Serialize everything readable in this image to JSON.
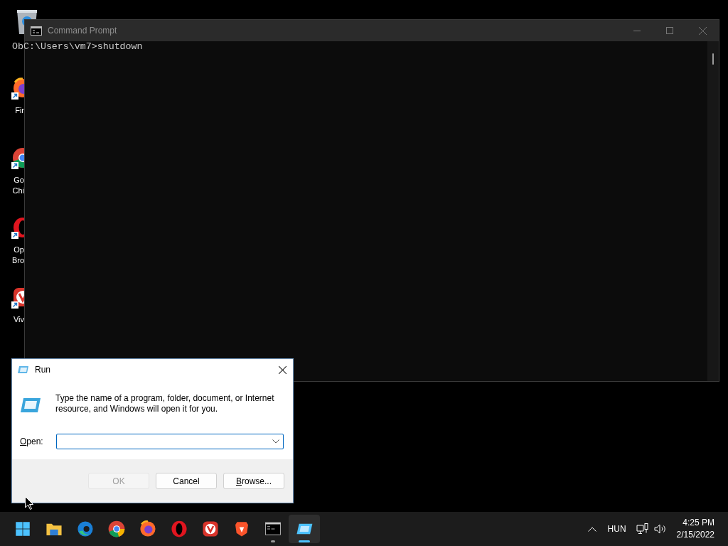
{
  "desktop_icons": [
    {
      "kind": "recycle-bin"
    },
    {
      "kind": "firefox",
      "label_lines": [
        "Fir"
      ]
    },
    {
      "kind": "chrome",
      "label_lines": [
        "Go",
        "Chi"
      ]
    },
    {
      "kind": "opera",
      "label_lines": [
        "Op",
        "Bro"
      ]
    },
    {
      "kind": "vivaldi",
      "label_lines": [
        "Viv"
      ]
    }
  ],
  "console_window": {
    "title": "Command Prompt",
    "lines": [
      "ObC:\\Users\\vm7>shutdown"
    ]
  },
  "run_dialog": {
    "title": "Run",
    "message": "Type the name of a program, folder, document, or Internet resource, and Windows will open it for you.",
    "open_label": "Open:",
    "open_label_access_key_underlined": true,
    "buttons": [
      {
        "label": "OK",
        "disabled": true
      },
      {
        "label": "Cancel",
        "disabled": false
      },
      {
        "label": "Browse...",
        "access_key_underlined": true,
        "disabled": false
      }
    ]
  },
  "taskbar": {
    "apps": [
      {
        "kind": "start",
        "running": false,
        "selected": false
      },
      {
        "kind": "folder",
        "running": false,
        "selected": false
      },
      {
        "kind": "edge",
        "running": false,
        "selected": false
      },
      {
        "kind": "chrome",
        "running": false,
        "selected": false
      },
      {
        "kind": "firefox",
        "running": false,
        "selected": false
      },
      {
        "kind": "opera",
        "running": false,
        "selected": false
      },
      {
        "kind": "vivaldi",
        "running": false,
        "selected": false
      },
      {
        "kind": "brave",
        "running": false,
        "selected": false
      },
      {
        "kind": "console",
        "running": true,
        "selected": false
      },
      {
        "kind": "run",
        "running": true,
        "selected": true
      }
    ],
    "tray": {
      "language": "HUN",
      "time": "4:25 PM",
      "date": "2/15/2022"
    }
  }
}
